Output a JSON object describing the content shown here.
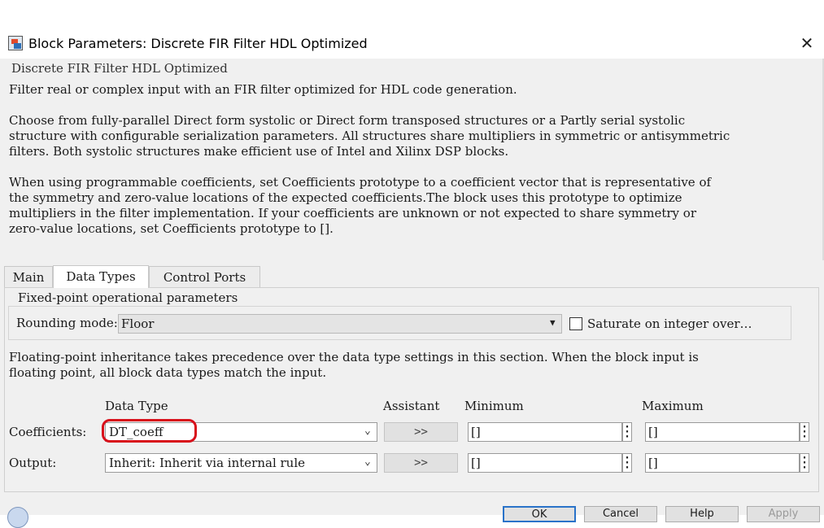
{
  "window": {
    "title": "Block Parameters: Discrete FIR Filter HDL Optimized",
    "close_glyph": "✕"
  },
  "description": {
    "heading": "Discrete FIR Filter HDL Optimized",
    "intro": "Filter real or complex input with an FIR filter optimized for HDL code generation.",
    "para1": "Choose from fully-parallel Direct form systolic or Direct form transposed structures or a Partly serial systolic\nstructure with configurable serialization parameters. All structures share multipliers in symmetric or antisymmetric\nfilters. Both systolic structures make efficient use of Intel and Xilinx DSP blocks.",
    "para2": "When using programmable coefficients, set Coefficients prototype to a coefficient vector that is representative of\nthe symmetry and zero-value locations of the expected coefficients.The block uses this prototype to optimize\nmultipliers in the filter implementation. If your coefficients are unknown or not expected to share symmetry or\nzero-value locations, set Coefficients prototype to []."
  },
  "tabs": [
    {
      "label": "Main",
      "active": false
    },
    {
      "label": "Data Types",
      "active": true
    },
    {
      "label": "Control Ports",
      "active": false
    }
  ],
  "fixed_point": {
    "legend": "Fixed-point operational parameters",
    "rounding_label": "Rounding mode:",
    "rounding_value": "Floor",
    "saturate_label": "Saturate on integer over…",
    "saturate_checked": false
  },
  "float_note": "Floating-point inheritance takes precedence over the data type settings in this section. When the block input is\nfloating point, all block data types match the input.",
  "datatype_table": {
    "headers": {
      "data_type": "Data Type",
      "assistant": "Assistant",
      "minimum": "Minimum",
      "maximum": "Maximum"
    },
    "rows": [
      {
        "label": "Coefficients:",
        "data_type": "DT_coeff",
        "assistant": ">>",
        "minimum": "[]",
        "maximum": "[]",
        "highlighted": true
      },
      {
        "label": "Output:",
        "data_type": "Inherit: Inherit via internal rule",
        "assistant": ">>",
        "minimum": "[]",
        "maximum": "[]",
        "highlighted": false
      }
    ]
  },
  "buttons": {
    "ok": "OK",
    "cancel": "Cancel",
    "help": "Help",
    "apply": "Apply"
  },
  "icons": {
    "window_icon": "simulink-block-icon",
    "help_icon": "help-globe-icon",
    "dropdown": "chevron-down-icon",
    "kebab": "vertical-ellipsis-icon"
  },
  "colors": {
    "highlight": "#d80f1a",
    "ok_border": "#2a73c9",
    "panel_bg": "#f0f0f0"
  }
}
